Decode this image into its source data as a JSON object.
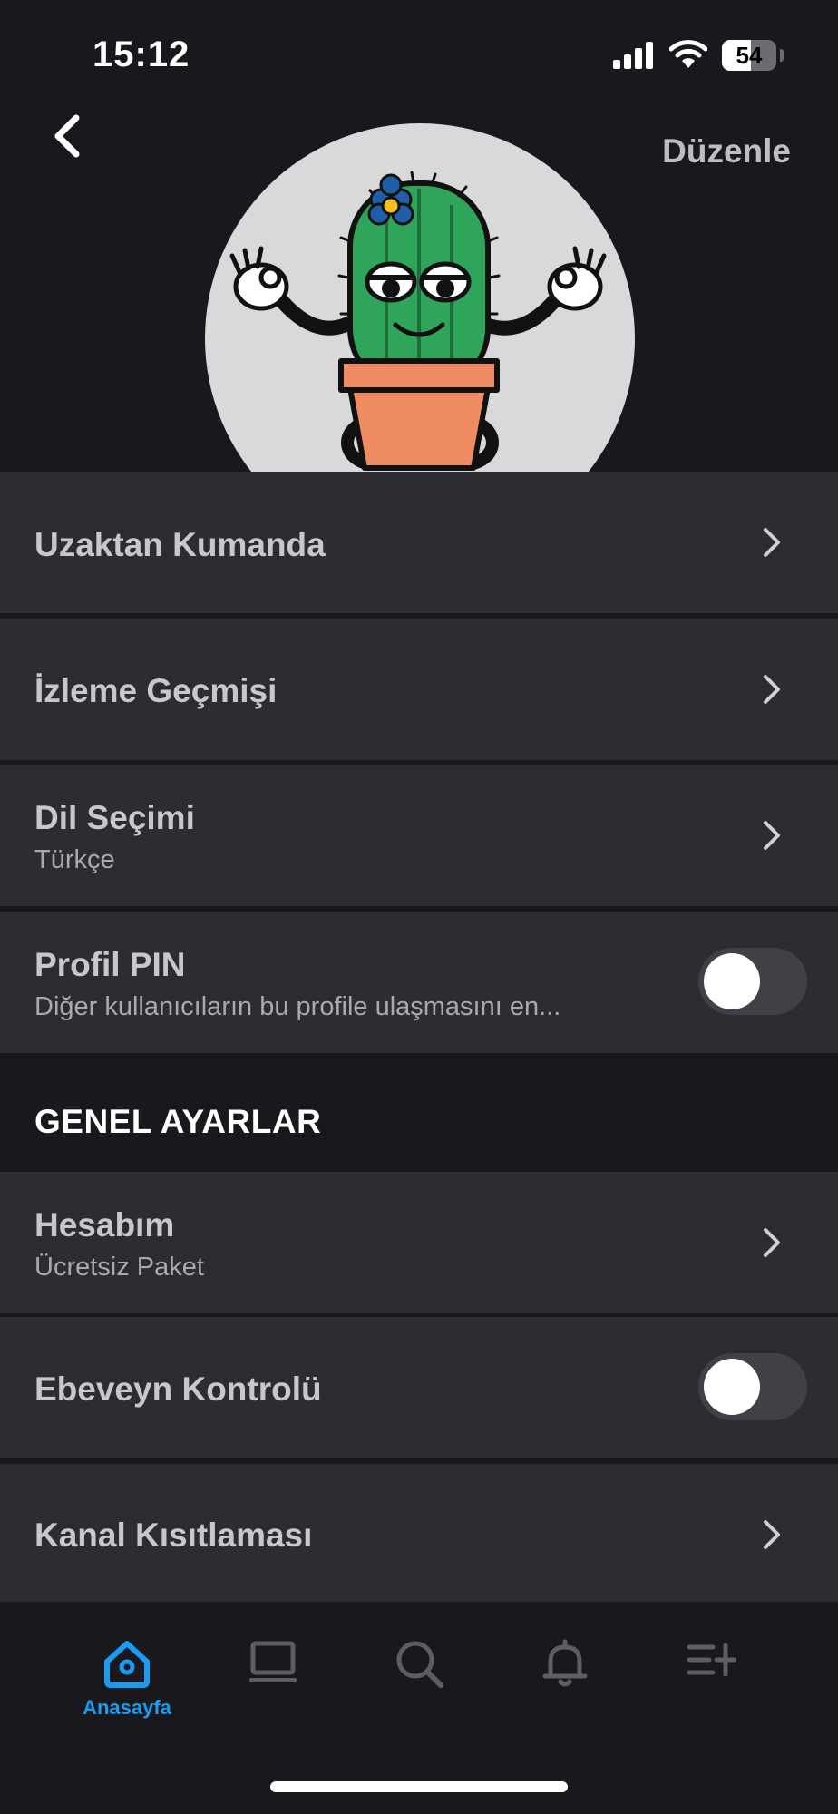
{
  "status_bar": {
    "time": "15:12",
    "battery_percent": "54",
    "battery_level": 0.54
  },
  "header": {
    "edit_label": "Düzenle"
  },
  "menu": {
    "remote": {
      "title": "Uzaktan Kumanda"
    },
    "history": {
      "title": "İzleme Geçmişi"
    },
    "language": {
      "title": "Dil Seçimi",
      "subtitle": "Türkçe"
    },
    "pin": {
      "title": "Profil PIN",
      "subtitle": "Diğer kullanıcıların bu profile ulaşmasını en...",
      "enabled": false
    }
  },
  "general": {
    "section_title": "GENEL AYARLAR",
    "account": {
      "title": "Hesabım",
      "subtitle": "Ücretsiz Paket"
    },
    "parental": {
      "title": "Ebeveyn Kontrolü",
      "enabled": false
    },
    "channel": {
      "title": "Kanal Kısıtlaması"
    }
  },
  "tab_bar": {
    "active_color": "#1a9cf0",
    "inactive_color": "#5d5d63",
    "tabs": [
      {
        "icon": "home-icon",
        "label": "Anasayfa",
        "active": true
      },
      {
        "icon": "laptop-icon",
        "label": "",
        "active": false
      },
      {
        "icon": "search-icon",
        "label": "",
        "active": false
      },
      {
        "icon": "bell-icon",
        "label": "",
        "active": false
      },
      {
        "icon": "playlist-add-icon",
        "label": "",
        "active": false
      }
    ]
  }
}
